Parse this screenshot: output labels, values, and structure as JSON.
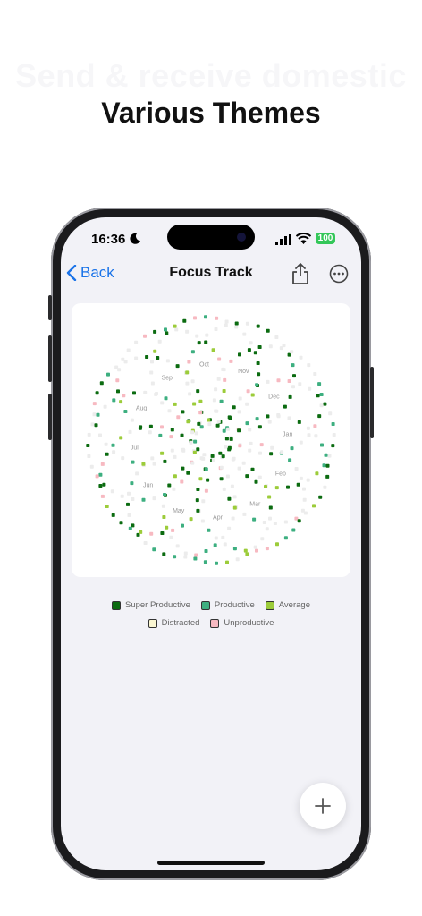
{
  "promo": {
    "ghost_text": "Send & receive domestic",
    "headline": "Various Themes"
  },
  "status_bar": {
    "time": "16:36",
    "battery": "100",
    "icons": [
      "moon-icon",
      "cellular-signal-icon",
      "wifi-icon",
      "battery-icon"
    ]
  },
  "nav": {
    "back_label": "Back",
    "title": "Focus Track",
    "icons": [
      "chevron-left-icon",
      "share-icon",
      "ellipsis-circle-icon"
    ]
  },
  "chart_data": {
    "type": "radial-dot-calendar",
    "months": [
      "Jan",
      "Feb",
      "Mar",
      "Apr",
      "May",
      "Jun",
      "Jul",
      "Aug",
      "Sep",
      "Oct",
      "Nov",
      "Dec"
    ],
    "categories": [
      {
        "key": "super_productive",
        "label": "Super Productive",
        "color": "#0b6b10"
      },
      {
        "key": "productive",
        "label": "Productive",
        "color": "#3daf80"
      },
      {
        "key": "average",
        "label": "Average",
        "color": "#9ccc3a"
      },
      {
        "key": "distracted",
        "label": "Distracted",
        "color": "#fbf7d2"
      },
      {
        "key": "unproductive",
        "label": "Unproductive",
        "color": "#f7b9c1"
      }
    ],
    "empty_color": "#ececec"
  },
  "legend": {
    "row1": [
      "Super Productive",
      "Productive",
      "Average"
    ],
    "row2": [
      "Distracted",
      "Unproductive"
    ]
  },
  "fab_icon": "plus-icon"
}
